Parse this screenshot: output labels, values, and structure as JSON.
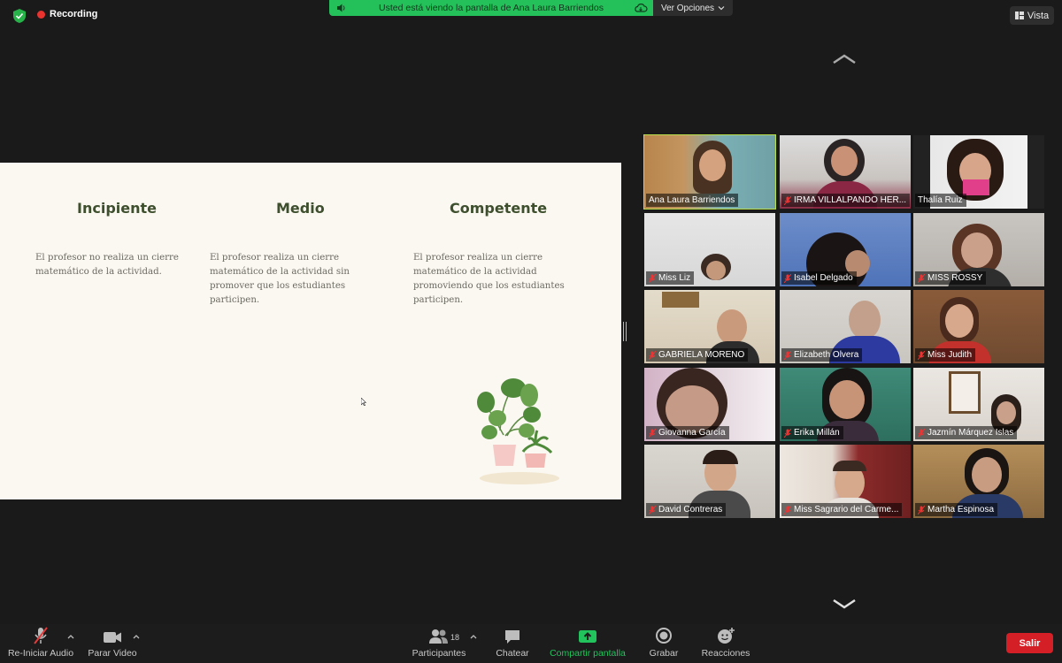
{
  "top_bar": {
    "recording_label": "Recording",
    "share_banner_text": "Usted está viendo la pantalla de Ana Laura Barriendos",
    "view_options_label": "Ver Opciones",
    "view_button_label": "Vista"
  },
  "slide": {
    "columns": [
      {
        "title": "Incipiente",
        "text": "El profesor no realiza un cierre matemático de la actividad."
      },
      {
        "title": "Medio",
        "text": "El profesor realiza un cierre matemático de la actividad sin promover que los estudiantes participen."
      },
      {
        "title": "Competente",
        "text": "El profesor realiza un cierre matemático de la actividad promoviendo que los estudiantes participen."
      }
    ]
  },
  "participants": [
    {
      "name": "Ana Laura Barriendos",
      "muted": false
    },
    {
      "name": "IRMA VILLALPANDO HER...",
      "muted": true
    },
    {
      "name": "Thalía Ruiz",
      "muted": false
    },
    {
      "name": "Miss Liz",
      "muted": true
    },
    {
      "name": "Isabel Delgado",
      "muted": true
    },
    {
      "name": "MISS ROSSY",
      "muted": true
    },
    {
      "name": "GABRIELA MORENO",
      "muted": true
    },
    {
      "name": "Elizabeth Olvera",
      "muted": true
    },
    {
      "name": "Miss Judith",
      "muted": true
    },
    {
      "name": "Giovanna García",
      "muted": true
    },
    {
      "name": "Erika Millán",
      "muted": true
    },
    {
      "name": "Jazmín Márquez Islas",
      "muted": true
    },
    {
      "name": "David Contreras",
      "muted": true
    },
    {
      "name": "Miss Sagrario del Carme...",
      "muted": true
    },
    {
      "name": "Martha Espinosa",
      "muted": true
    }
  ],
  "toolbar": {
    "audio_label": "Re-Iniciar Audio",
    "video_label": "Parar Video",
    "participants_label": "Participantes",
    "participants_count": "18",
    "chat_label": "Chatear",
    "share_label": "Compartir pantalla",
    "record_label": "Grabar",
    "reactions_label": "Reacciones",
    "exit_label": "Salir"
  },
  "colors": {
    "share_green": "#24c15a",
    "active_speaker": "#b9e04b",
    "exit_red": "#d41f27",
    "slide_bg": "#fbf7f1",
    "slide_title": "#3d4f2d"
  }
}
